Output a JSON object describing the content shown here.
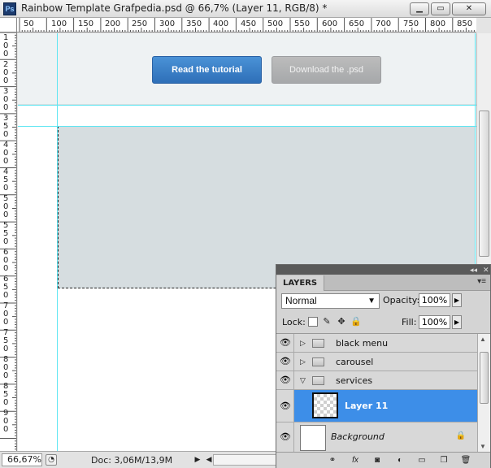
{
  "window": {
    "title": "Rainbow Template Grafpedia.psd @ 66,7% (Layer 11, RGB/8) *",
    "app_icon": "Ps",
    "minimize_label": "▁",
    "maximize_label": "▭",
    "close_label": "✕"
  },
  "ruler_top": [
    "50",
    "100",
    "150",
    "200",
    "250",
    "300",
    "350",
    "400",
    "450",
    "500",
    "550",
    "600",
    "650",
    "700",
    "750",
    "800",
    "850"
  ],
  "ruler_left": [
    "1 0 0",
    "2 0 0",
    "3 0 0",
    "3 5 0",
    "4 0 0",
    "4 5 0",
    "5 0 0",
    "5 5 0",
    "6 0 0",
    "6 5 0",
    "7 0 0",
    "7 5 0",
    "8 0 0",
    "8 5 0",
    "9 0 0"
  ],
  "canvas": {
    "read_button": "Read the tutorial",
    "download_button": "Download the .psd"
  },
  "status": {
    "zoom": "66,67%",
    "doc": "Doc: 3,06M/13,9M"
  },
  "layers_panel": {
    "tab": "LAYERS",
    "blend_mode": "Normal",
    "opacity_label": "Opacity:",
    "opacity_value": "100%",
    "lock_label": "Lock:",
    "fill_label": "Fill:",
    "fill_value": "100%",
    "layers": [
      {
        "name": "black menu",
        "type": "group",
        "expanded": false,
        "visible": true
      },
      {
        "name": "carousel",
        "type": "group",
        "expanded": false,
        "visible": true
      },
      {
        "name": "services",
        "type": "group",
        "expanded": true,
        "visible": true
      },
      {
        "name": "Layer 11",
        "type": "layer",
        "selected": true,
        "visible": true
      },
      {
        "name": "Background",
        "type": "background",
        "locked": true,
        "visible": true
      }
    ]
  },
  "colors": {
    "accent_blue": "#3d8ee8",
    "guide_cyan": "#5ee6f2",
    "read_button": "#2e6fb8"
  }
}
